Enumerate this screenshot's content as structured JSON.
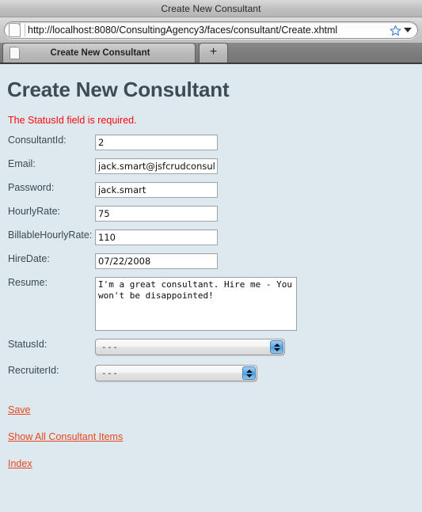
{
  "browser": {
    "window_title": "Create New Consultant",
    "url": "http://localhost:8080/ConsultingAgency3/faces/consultant/Create.xhtml",
    "bookmark_icon": "star-icon",
    "url_dropdown_icon": "chevron-down-icon",
    "page_icon": "document-icon",
    "tabs": [
      {
        "title": "Create New Consultant",
        "icon": "document-icon",
        "active": true
      }
    ],
    "new_tab_label": "+"
  },
  "page": {
    "heading": "Create New Consultant",
    "error_message": "The StatusId field is required.",
    "fields": [
      {
        "label": "ConsultantId:",
        "value": "2",
        "type": "text"
      },
      {
        "label": "Email:",
        "value": "jack.smart@jsfcrudconsulta",
        "type": "text"
      },
      {
        "label": "Password:",
        "value": "jack.smart",
        "type": "text"
      },
      {
        "label": "HourlyRate:",
        "value": "75",
        "type": "text"
      },
      {
        "label": "BillableHourlyRate:",
        "value": "110",
        "type": "text"
      },
      {
        "label": "HireDate:",
        "value": "07/22/2008",
        "type": "text"
      },
      {
        "label": "Resume:",
        "value": "I'm a great consultant. Hire me - You won't be disappointed!",
        "type": "textarea"
      },
      {
        "label": "StatusId:",
        "value": "---",
        "type": "select"
      },
      {
        "label": "RecruiterId:",
        "value": "---",
        "type": "select"
      }
    ],
    "links": [
      {
        "label": "Save"
      },
      {
        "label": "Show All Consultant Items"
      },
      {
        "label": "Index"
      }
    ]
  },
  "colors": {
    "page_background": "#dde8ef",
    "heading": "#3d4c54",
    "error": "#fb0a0a",
    "link": "#e8471f",
    "chrome": "#c0c0c0",
    "tabstrip": "#7d7d7d"
  }
}
